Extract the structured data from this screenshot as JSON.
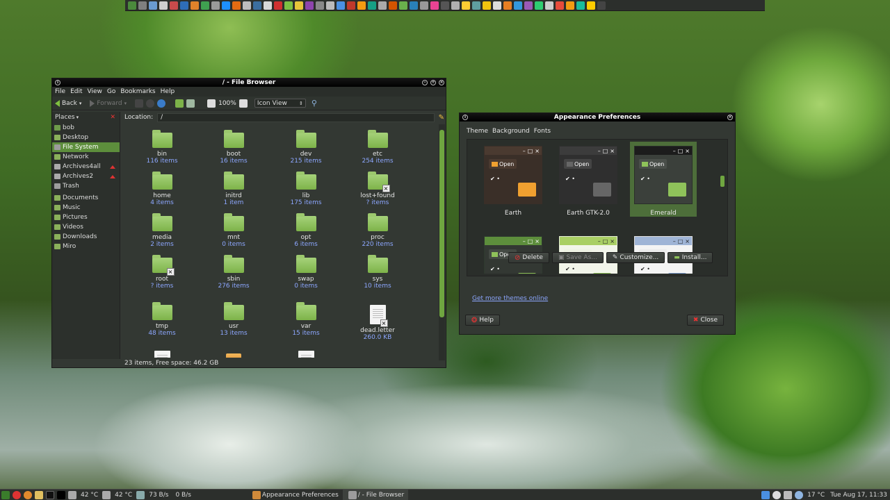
{
  "topbar": {
    "icon_colors": [
      "#4b8a3c",
      "#7f7f7f",
      "#6a9ad0",
      "#cfcfcf",
      "#c94b4b",
      "#2e6db8",
      "#e0822a",
      "#3fa050",
      "#9a9a9a",
      "#1e90ff",
      "#e56b12",
      "#bdbdbd",
      "#3b6e9e",
      "#d8d8d8",
      "#cf3030",
      "#7bc043",
      "#e7c53a",
      "#8e44ad",
      "#888",
      "#bbb",
      "#4a90e2",
      "#c0392b",
      "#f39c12",
      "#16a085",
      "#aaaaaa",
      "#d35400",
      "#6ab04c",
      "#2980b9",
      "#999999",
      "#e84393",
      "#555555",
      "#b0b0b0",
      "#ffcc33",
      "#5f9ea0",
      "#f1c40f",
      "#dcdcdc",
      "#e67e22",
      "#3498db",
      "#9b59b6",
      "#2ecc71",
      "#cccccc",
      "#e74c3c",
      "#f39c12",
      "#1abc9c",
      "#ffcc00",
      "#444444"
    ]
  },
  "file_browser": {
    "title": "/ - File Browser",
    "menu": [
      "File",
      "Edit",
      "View",
      "Go",
      "Bookmarks",
      "Help"
    ],
    "toolbar": {
      "back": "Back",
      "forward": "Forward",
      "zoom": "100%",
      "view_mode": "Icon View"
    },
    "location_label": "Location:",
    "location_value": "/",
    "places_label": "Places",
    "sidebar": [
      {
        "label": "bob",
        "color": "#6e9a4a"
      },
      {
        "label": "Desktop",
        "color": "#8ab05a"
      },
      {
        "label": "File System",
        "color": "#9c9c9c",
        "selected": true
      },
      {
        "label": "Network",
        "color": "#8ab05a"
      },
      {
        "label": "Archives4all",
        "color": "#aaaaaa",
        "eject": true
      },
      {
        "label": "Archives2",
        "color": "#aaaaaa",
        "eject": true
      },
      {
        "label": "Trash",
        "color": "#9c9c9c"
      },
      {
        "label": "Documents",
        "color": "#8ab05a"
      },
      {
        "label": "Music",
        "color": "#8ab05a"
      },
      {
        "label": "Pictures",
        "color": "#8ab05a"
      },
      {
        "label": "Videos",
        "color": "#8ab05a"
      },
      {
        "label": "Downloads",
        "color": "#8ab05a"
      },
      {
        "label": "Miro",
        "color": "#8ab05a"
      }
    ],
    "files": [
      {
        "name": "bin",
        "info": "116 items",
        "type": "folder"
      },
      {
        "name": "boot",
        "info": "16 items",
        "type": "folder"
      },
      {
        "name": "dev",
        "info": "215 items",
        "type": "folder"
      },
      {
        "name": "etc",
        "info": "254 items",
        "type": "folder"
      },
      {
        "name": "home",
        "info": "4 items",
        "type": "folder"
      },
      {
        "name": "initrd",
        "info": "1 item",
        "type": "folder"
      },
      {
        "name": "lib",
        "info": "175 items",
        "type": "folder"
      },
      {
        "name": "lost+found",
        "info": "? items",
        "type": "folder-locked"
      },
      {
        "name": "media",
        "info": "2 items",
        "type": "folder"
      },
      {
        "name": "mnt",
        "info": "0 items",
        "type": "folder"
      },
      {
        "name": "opt",
        "info": "6 items",
        "type": "folder"
      },
      {
        "name": "proc",
        "info": "220 items",
        "type": "folder"
      },
      {
        "name": "root",
        "info": "? items",
        "type": "folder-locked"
      },
      {
        "name": "sbin",
        "info": "276 items",
        "type": "folder"
      },
      {
        "name": "swap",
        "info": "0 items",
        "type": "folder"
      },
      {
        "name": "sys",
        "info": "10 items",
        "type": "folder"
      },
      {
        "name": "tmp",
        "info": "48 items",
        "type": "folder"
      },
      {
        "name": "usr",
        "info": "13 items",
        "type": "folder"
      },
      {
        "name": "var",
        "info": "15 items",
        "type": "folder"
      },
      {
        "name": "dead.letter",
        "info": "260.0 KB",
        "type": "doc-locked"
      },
      {
        "name": "",
        "info": "",
        "type": "doc"
      },
      {
        "name": "",
        "info": "",
        "type": "package"
      },
      {
        "name": "",
        "info": "",
        "type": "doc"
      }
    ],
    "status": "23 items, Free space: 46.2 GB"
  },
  "appearance": {
    "title": "Appearance Preferences",
    "tabs": [
      "Theme",
      "Background",
      "Fonts"
    ],
    "themes": [
      {
        "name": "Earth",
        "frame": "#3a2f28",
        "title_bg": "#4a3a30",
        "body": "#3a2f28",
        "btn_bg": "#4a3a30",
        "btn_fg": "#ffffff",
        "accent": "#f0a030",
        "selected": false
      },
      {
        "name": "Earth GTK-2.0",
        "frame": "#2f2f2f",
        "title_bg": "#3c3c3c",
        "body": "#2f2f2f",
        "btn_bg": "#444444",
        "btn_fg": "#ffffff",
        "accent": "#666666",
        "selected": false
      },
      {
        "name": "Emerald",
        "frame": "#2a2e2a",
        "title_bg": "#1c1c1c",
        "body": "#3b403b",
        "btn_bg": "#4a4f4a",
        "btn_fg": "#ffffff",
        "accent": "#8fc25a",
        "selected": true
      },
      {
        "name": "",
        "frame": "#2f3a2f",
        "title_bg": "#5d8e3c",
        "body": "#333833",
        "btn_bg": "#444a44",
        "btn_fg": "#ffffff",
        "accent": "#8fc25a",
        "selected": false
      },
      {
        "name": "",
        "frame": "#e8f0d8",
        "title_bg": "#a9cf64",
        "body": "#f2f5ea",
        "btn_bg": "#eef3e4",
        "btn_fg": "#222222",
        "accent": "#8fc25a",
        "selected": false
      },
      {
        "name": "",
        "frame": "#e0e0e0",
        "title_bg": "#9fb4d6",
        "body": "#f4f4f4",
        "btn_bg": "#ececec",
        "btn_fg": "#222222",
        "accent": "#7f9fd0",
        "selected": false
      }
    ],
    "buttons": {
      "delete": "Delete",
      "save_as": "Save As...",
      "customize": "Customize...",
      "install": "Install..."
    },
    "link": "Get more themes online",
    "help": "Help",
    "close": "Close"
  },
  "taskbar": {
    "temp1": "42 °C",
    "temp2": "42 °C",
    "net_down": "73 B/s",
    "net_up": "0 B/s",
    "tasks": [
      "Appearance Preferences",
      "/ - File Browser"
    ],
    "weather": "17 °C",
    "clock": "Tue Aug 17, 11:33"
  }
}
